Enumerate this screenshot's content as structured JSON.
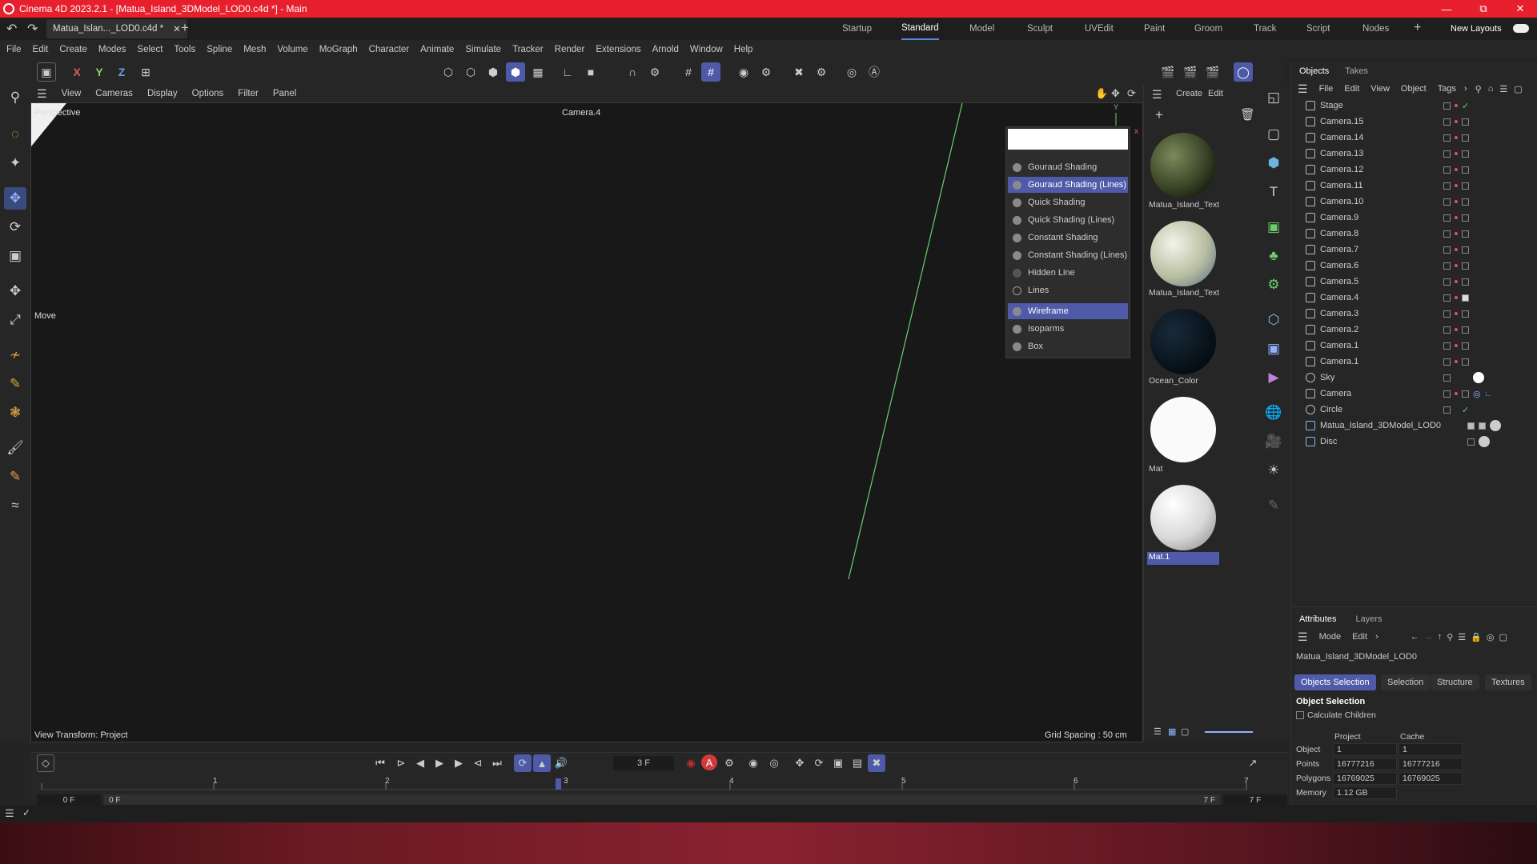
{
  "title": "Cinema 4D 2023.2.1 - [Matua_Island_3DModel_LOD0.c4d *] - Main",
  "doc_tab": "Matua_Islan..._LOD0.c4d *",
  "layout_tabs": [
    "Startup",
    "Standard",
    "Model",
    "Sculpt",
    "UVEdit",
    "Paint",
    "Groom",
    "Track",
    "Script",
    "Nodes"
  ],
  "new_layouts": "New Layouts",
  "menu": [
    "File",
    "Edit",
    "Create",
    "Modes",
    "Select",
    "Tools",
    "Spline",
    "Mesh",
    "Volume",
    "MoGraph",
    "Character",
    "Animate",
    "Simulate",
    "Tracker",
    "Render",
    "Extensions",
    "Arnold",
    "Window",
    "Help"
  ],
  "axis": {
    "x": "X",
    "y": "Y",
    "z": "Z"
  },
  "viewport_menu": [
    "View",
    "Cameras",
    "Display",
    "Options",
    "Filter",
    "Panel"
  ],
  "viewport": {
    "perspective": "Perspective",
    "camera": "Camera.4",
    "move_label": "Move",
    "view_transform": "View Transform: Project",
    "grid_spacing": "Grid Spacing : 50 cm"
  },
  "shading_menu": [
    "Gouraud Shading",
    "Gouraud Shading (Lines)",
    "Quick Shading",
    "Quick Shading (Lines)",
    "Constant Shading",
    "Constant Shading (Lines)",
    "Hidden Line",
    "Lines",
    "Wireframe",
    "Isoparms",
    "Box"
  ],
  "mat_menu": {
    "create": "Create",
    "edit": "Edit"
  },
  "materials": [
    "Matua_Island_Text",
    "Matua_Island_Text",
    "Ocean_Color",
    "Mat",
    "Mat.1"
  ],
  "objects_tabs": {
    "objects": "Objects",
    "takes": "Takes"
  },
  "objects_menu": [
    "File",
    "Edit",
    "View",
    "Object",
    "Tags"
  ],
  "objects": [
    "Stage",
    "Camera.15",
    "Camera.14",
    "Camera.13",
    "Camera.12",
    "Camera.11",
    "Camera.10",
    "Camera.9",
    "Camera.8",
    "Camera.7",
    "Camera.6",
    "Camera.5",
    "Camera.4",
    "Camera.3",
    "Camera.2",
    "Camera.1",
    "Camera.1",
    "Sky",
    "Camera",
    "Circle",
    "Matua_Island_3DModel_LOD0",
    "Disc"
  ],
  "attributes": {
    "tabs": {
      "attributes": "Attributes",
      "layers": "Layers"
    },
    "menu": {
      "mode": "Mode",
      "edit": "Edit"
    },
    "object_name": "Matua_Island_3DModel_LOD0",
    "subtabs": [
      "Objects Selection",
      "Selection",
      "Structure",
      "Textures"
    ],
    "section": "Object Selection",
    "calc_children": "Calculate Children",
    "col_project": "Project",
    "col_cache": "Cache",
    "rows": [
      {
        "label": "Object",
        "project": "1",
        "cache": "1"
      },
      {
        "label": "Points",
        "project": "16777216",
        "cache": "16777216"
      },
      {
        "label": "Polygons",
        "project": "16769025",
        "cache": "16769025"
      },
      {
        "label": "Memory",
        "project": "1.12 GB",
        "cache": ""
      }
    ]
  },
  "timeline": {
    "frame": "3 F",
    "ruler": [
      "1",
      "2",
      "3",
      "4",
      "5",
      "6",
      "7"
    ],
    "start": "0 F",
    "start2": "0 F",
    "end": "7 F",
    "end2": "7 F"
  }
}
